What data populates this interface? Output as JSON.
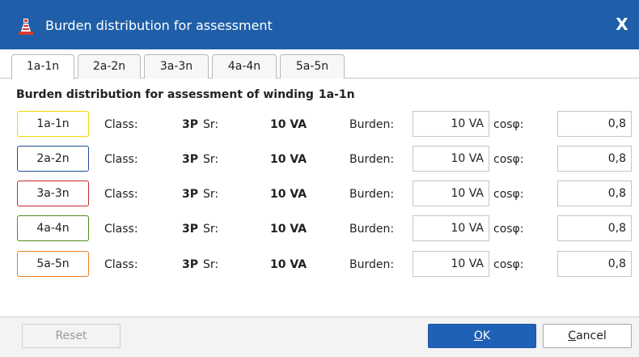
{
  "window": {
    "title": "Burden distribution for assessment",
    "close_label": "X"
  },
  "tabs": [
    {
      "label": "1a-1n",
      "active": true
    },
    {
      "label": "2a-2n",
      "active": false
    },
    {
      "label": "3a-3n",
      "active": false
    },
    {
      "label": "4a-4n",
      "active": false
    },
    {
      "label": "5a-5n",
      "active": false
    }
  ],
  "section": {
    "title": "Burden distribution for assessment of winding",
    "winding": "1a-1n"
  },
  "labels": {
    "class": "Class:",
    "sr": "Sr:",
    "burden": "Burden:",
    "cosphi": "cosφ:"
  },
  "windings": [
    {
      "name": "1a-1n",
      "color": "#f0d800",
      "class_value": "3P",
      "sr": "10 VA",
      "burden": "10 VA",
      "cosphi": "0,8"
    },
    {
      "name": "2a-2n",
      "color": "#1f4f9a",
      "class_value": "3P",
      "sr": "10 VA",
      "burden": "10 VA",
      "cosphi": "0,8"
    },
    {
      "name": "3a-3n",
      "color": "#c62828",
      "class_value": "3P",
      "sr": "10 VA",
      "burden": "10 VA",
      "cosphi": "0,8"
    },
    {
      "name": "4a-4n",
      "color": "#4c8c1c",
      "class_value": "3P",
      "sr": "10 VA",
      "burden": "10 VA",
      "cosphi": "0,8"
    },
    {
      "name": "5a-5n",
      "color": "#e67e22",
      "class_value": "3P",
      "sr": "10 VA",
      "burden": "10 VA",
      "cosphi": "0,8"
    }
  ],
  "buttons": {
    "reset": "Reset",
    "ok_underlined": "O",
    "ok_rest": "K",
    "cancel_underlined": "C",
    "cancel_rest": "ancel"
  },
  "colors": {
    "titlebar": "#1f5ea8",
    "ok_button": "#1f61b6"
  },
  "icons": {
    "app": "transformer-app-icon",
    "close": "close-icon"
  }
}
